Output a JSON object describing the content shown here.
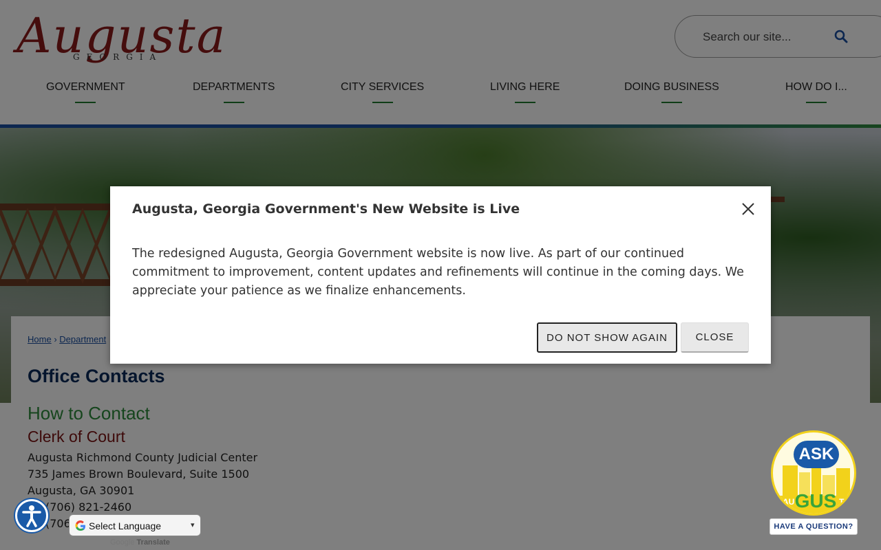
{
  "site": {
    "logo_script": "Augusta",
    "logo_sub": "GEORGIA"
  },
  "search": {
    "placeholder": "Search our site..."
  },
  "nav": {
    "items": [
      {
        "label": "GOVERNMENT"
      },
      {
        "label": "DEPARTMENTS"
      },
      {
        "label": "CITY SERVICES"
      },
      {
        "label": "LIVING HERE"
      },
      {
        "label": "DOING BUSINESS"
      },
      {
        "label": "HOW DO I..."
      }
    ]
  },
  "breadcrumb": {
    "home": "Home",
    "separator": "›",
    "departments": "Department"
  },
  "content": {
    "page_title": "Office Contacts",
    "how_to_contact": "How to Contact",
    "clerk_heading": "Clerk of Court",
    "address_lines": [
      "Augusta Richmond County Judicial Center",
      "735 James Brown Boulevard, Suite 1500",
      "Augusta, GA 30901",
      "(706) 821-2460",
      "(706)"
    ]
  },
  "modal": {
    "title": "Augusta, Georgia Government's New Website is Live",
    "body": "The redesigned Augusta, Georgia Government website is now live. As part of our continued commitment to improvement, content updates and refinements will continue in the coming days. We appreciate your patience as we finalize enhancements.",
    "do_not_show_label": "DO NOT SHOW AGAIN",
    "close_label": "CLOSE"
  },
  "translate": {
    "select_label": "Select Language",
    "powered_by_google": "Google",
    "powered_by_translate": "Translate"
  },
  "gus": {
    "ask": "ASK",
    "name": "GUS",
    "au": "AU",
    "ta": "TA",
    "tagline": "HAVE A QUESTION?"
  },
  "colors": {
    "nav_underline": "#1f7a2e",
    "title_navy": "#0b2a5a",
    "contact_green": "#2c8a3a",
    "clerk_maroon": "#7a1313",
    "logo_red": "#8b1a1a"
  }
}
